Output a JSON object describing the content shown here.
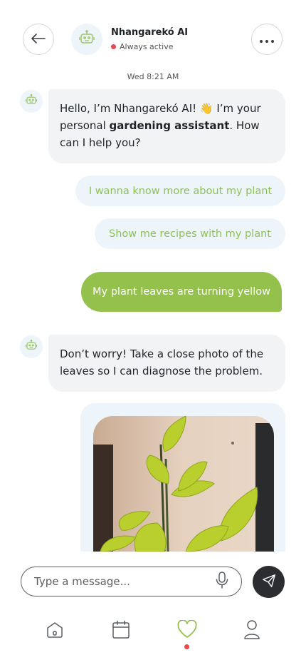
{
  "header": {
    "bot_name": "Nhangarekó AI",
    "status_text": "Always active",
    "back_icon": "arrow-left-icon",
    "more_icon": "more-horizontal-icon"
  },
  "timestamp": "Wed 8:21 AM",
  "messages": [
    {
      "from": "bot",
      "text_before": "Hello, I’m Nhangarekó AI! 👋 I’m your personal ",
      "bold": "gardening assistant",
      "text_after": ". How can I help you?"
    },
    {
      "from": "suggestion",
      "text": "I wanna know more about my plant"
    },
    {
      "from": "suggestion",
      "text": "Show me recipes with my plant"
    },
    {
      "from": "user",
      "text": "My plant leaves are turning yellow"
    },
    {
      "from": "bot",
      "text": "Don’t worry! Take a close photo of the leaves so I can diagnose the problem."
    },
    {
      "from": "user_photo",
      "alt": "Photo of pothos plant leaves"
    }
  ],
  "composer": {
    "placeholder": "Type a message...",
    "mic_icon": "microphone-icon",
    "send_icon": "send-icon"
  },
  "nav": [
    {
      "name": "home",
      "icon": "home-icon",
      "active": false
    },
    {
      "name": "calendar",
      "icon": "calendar-icon",
      "active": false
    },
    {
      "name": "favorites",
      "icon": "heart-icon",
      "active": true
    },
    {
      "name": "profile",
      "icon": "user-icon",
      "active": false
    }
  ],
  "colors": {
    "accent_green": "#94c14b",
    "suggestion_text": "#8ec05a",
    "suggestion_bg": "#eef5fa",
    "bot_bubble_bg": "#f2f3f5",
    "status_red": "#e5484d",
    "send_button_bg": "#2b2d30"
  }
}
